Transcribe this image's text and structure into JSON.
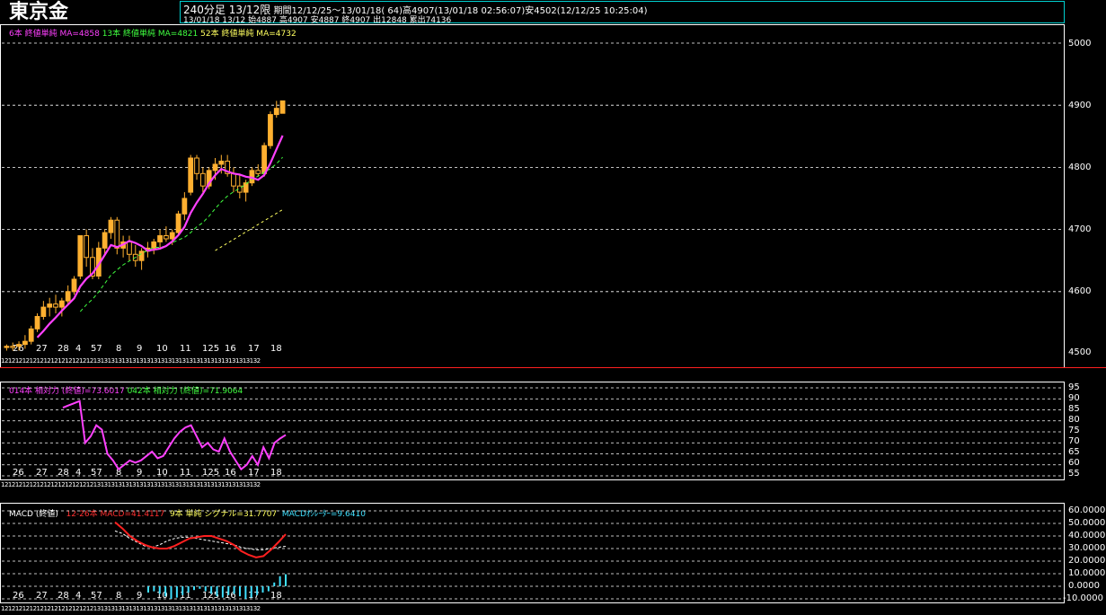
{
  "header": {
    "title": "東京金",
    "timeframe": "240分足 13/12限",
    "period": "期間12/12/25～13/01/18( 64)高4907(13/01/18 02:56:07)安4502(12/12/25 10:25:04)",
    "last_bar": "13/01/18 13/12 始4887 高4907 安4887 終4907 出12848 累出74136"
  },
  "price_panel": {
    "legend": [
      {
        "text": "6本 終値単純 MA=4858",
        "color": "#ff40ff"
      },
      {
        "text": "13本 終値単純 MA=4821",
        "color": "#40ff40"
      },
      {
        "text": "52本 終値単純 MA=4732",
        "color": "#ffff60"
      }
    ],
    "yticks": [
      "5000",
      "4900",
      "4800",
      "4700",
      "4600",
      "4500"
    ],
    "xlabels": [
      "26",
      "27",
      "28",
      "4",
      "57",
      "8",
      "9",
      "10",
      "11",
      "125",
      "16",
      "17",
      "18"
    ],
    "date_strip": "1212121212121212121212121213131313131313131313131313131313131313131313132"
  },
  "rsi_panel": {
    "legend": [
      {
        "text": "014本 相対力 (終値)=73.6017",
        "color": "#ff40ff"
      },
      {
        "text": "042本 相対力 (終値)=71.9064",
        "color": "#40ff40"
      }
    ],
    "yticks": [
      "95",
      "90",
      "85",
      "80",
      "75",
      "70",
      "65",
      "60",
      "55"
    ],
    "xlabels": [
      "26",
      "27",
      "28",
      "4",
      "57",
      "8",
      "9",
      "10",
      "11",
      "125",
      "16",
      "17",
      "18"
    ]
  },
  "macd_panel": {
    "legend": [
      {
        "text": "MACD (終値)",
        "color": "#ffffff"
      },
      {
        "text": "12-26本 MACD=41.4117",
        "color": "#ff3030"
      },
      {
        "text": "9本 単純 シグナル=31.7707",
        "color": "#ffff60"
      },
      {
        "text": "MACDｵｼﾚｰﾀｰ=9.6410",
        "color": "#40e0ff"
      }
    ],
    "yticks": [
      "60.0000",
      "50.0000",
      "40.0000",
      "30.0000",
      "20.0000",
      "10.0000",
      "0.0000",
      "-10.0000"
    ],
    "xlabels": [
      "26",
      "27",
      "28",
      "4",
      "57",
      "8",
      "9",
      "10",
      "11",
      "125",
      "16",
      "17",
      "18"
    ]
  },
  "colors": {
    "candle": "#ffb030",
    "ma6": "#ff40ff",
    "ma13": "#40ff40",
    "ma52": "#ffff60",
    "rsi": "#ff40ff",
    "macd": "#ff2020",
    "signal": "#ffffff",
    "osc": "#40e0ff"
  },
  "chart_data": [
    {
      "type": "candlestick",
      "title": "東京金",
      "ylim": [
        4500,
        5000
      ],
      "candles": [
        [
          4510,
          4515,
          4505,
          4512
        ],
        [
          4512,
          4518,
          4505,
          4510
        ],
        [
          4512,
          4520,
          4505,
          4515
        ],
        [
          4515,
          4530,
          4508,
          4520
        ],
        [
          4520,
          4545,
          4515,
          4540
        ],
        [
          4540,
          4565,
          4535,
          4560
        ],
        [
          4560,
          4585,
          4555,
          4575
        ],
        [
          4575,
          4590,
          4560,
          4580
        ],
        [
          4580,
          4595,
          4565,
          4575
        ],
        [
          4575,
          4590,
          4560,
          4585
        ],
        [
          4585,
          4610,
          4578,
          4600
        ],
        [
          4600,
          4625,
          4595,
          4620
        ],
        [
          4625,
          4690,
          4620,
          4690
        ],
        [
          4690,
          4700,
          4640,
          4655
        ],
        [
          4655,
          4670,
          4620,
          4625
        ],
        [
          4625,
          4680,
          4620,
          4670
        ],
        [
          4670,
          4700,
          4660,
          4695
        ],
        [
          4695,
          4720,
          4685,
          4715
        ],
        [
          4715,
          4720,
          4660,
          4670
        ],
        [
          4670,
          4690,
          4655,
          4680
        ],
        [
          4680,
          4690,
          4650,
          4660
        ],
        [
          4660,
          4675,
          4640,
          4650
        ],
        [
          4650,
          4670,
          4635,
          4665
        ],
        [
          4665,
          4680,
          4655,
          4670
        ],
        [
          4670,
          4685,
          4660,
          4680
        ],
        [
          4680,
          4700,
          4670,
          4690
        ],
        [
          4690,
          4705,
          4680,
          4685
        ],
        [
          4685,
          4700,
          4675,
          4695
        ],
        [
          4695,
          4730,
          4690,
          4725
        ],
        [
          4725,
          4760,
          4715,
          4750
        ],
        [
          4760,
          4820,
          4755,
          4815
        ],
        [
          4815,
          4820,
          4780,
          4790
        ],
        [
          4790,
          4800,
          4760,
          4770
        ],
        [
          4770,
          4800,
          4765,
          4795
        ],
        [
          4795,
          4815,
          4780,
          4805
        ],
        [
          4805,
          4820,
          4790,
          4810
        ],
        [
          4810,
          4820,
          4785,
          4790
        ],
        [
          4790,
          4800,
          4760,
          4770
        ],
        [
          4770,
          4790,
          4750,
          4760
        ],
        [
          4760,
          4780,
          4745,
          4775
        ],
        [
          4775,
          4800,
          4770,
          4795
        ],
        [
          4795,
          4805,
          4785,
          4790
        ],
        [
          4790,
          4840,
          4785,
          4835
        ],
        [
          4835,
          4890,
          4830,
          4885
        ],
        [
          4885,
          4907,
          4880,
          4895
        ],
        [
          4887,
          4907,
          4887,
          4907
        ]
      ],
      "ma6_last": 4858,
      "ma13_last": 4821,
      "ma52_last": 4732
    },
    {
      "type": "line",
      "title": "相対力",
      "ylim": [
        55,
        95
      ],
      "series": [
        {
          "name": "014本 相対力 (終値)",
          "values": [
            86,
            87,
            88,
            89,
            70,
            73,
            78,
            76,
            65,
            62,
            58,
            60,
            62,
            61,
            62,
            64,
            66,
            63,
            64,
            68,
            72,
            75,
            77,
            78,
            73,
            68,
            70,
            67,
            66,
            72,
            66,
            62,
            58,
            60,
            64,
            60,
            68,
            63,
            70,
            72,
            73.6
          ]
        }
      ]
    },
    {
      "type": "line",
      "title": "MACD (終値)",
      "ylim": [
        -10,
        60
      ],
      "series": [
        {
          "name": "12-26本 MACD",
          "values": [
            51,
            46,
            40,
            36,
            33,
            31,
            30,
            30,
            32,
            35,
            38,
            39,
            40,
            40,
            38,
            36,
            33,
            28,
            25,
            23,
            24,
            29,
            35,
            41.4
          ]
        },
        {
          "name": "9本 単純 シグナル",
          "values": [
            44,
            42,
            38,
            35,
            32,
            31,
            33,
            36,
            38,
            39,
            39,
            38,
            37,
            36,
            35,
            34,
            33,
            31,
            30,
            29,
            29,
            30,
            31,
            31.8
          ]
        }
      ],
      "oscillator": [
        -5,
        -4,
        -6,
        -8,
        -10,
        -9,
        -7,
        -5,
        -3,
        -2,
        -4,
        -6,
        -8,
        -9,
        -7,
        -6,
        -8,
        -10,
        -9,
        -7,
        -5,
        -4,
        3,
        8,
        9.6
      ]
    }
  ]
}
